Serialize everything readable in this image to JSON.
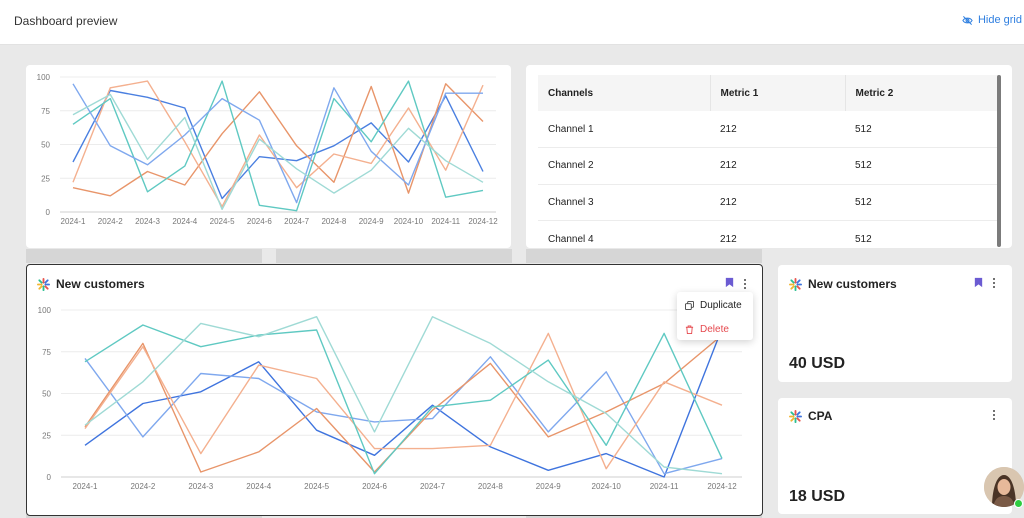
{
  "header": {
    "title": "Dashboard preview",
    "hide_grid_label": "Hide grid"
  },
  "colors": {
    "accent": "#2f7fe0",
    "delete": "#e5484d",
    "badge": "#6b5bd2",
    "border": "#333333"
  },
  "table": {
    "headers": [
      "Channels",
      "Metric 1",
      "Metric 2"
    ],
    "rows": [
      [
        "Channel 1",
        "212",
        "512"
      ],
      [
        "Channel 2",
        "212",
        "512"
      ],
      [
        "Channel 3",
        "212",
        "512"
      ],
      [
        "Channel 4",
        "212",
        "512"
      ]
    ]
  },
  "cards": {
    "new_customers_chart": {
      "title": "New customers"
    },
    "new_customers_metric": {
      "title": "New customers",
      "value": "40 USD"
    },
    "cpa_metric": {
      "title": "CPA",
      "value": "18 USD"
    }
  },
  "menu": {
    "duplicate_label": "Duplicate",
    "delete_label": "Delete"
  },
  "chart_data": [
    {
      "type": "line",
      "title": "",
      "xlabel": "",
      "ylabel": "",
      "categories": [
        "2024-1",
        "2024-2",
        "2024-3",
        "2024-4",
        "2024-5",
        "2024-6",
        "2024-7",
        "2024-8",
        "2024-9",
        "2024-10",
        "2024-11",
        "2024-12"
      ],
      "ylim": [
        0,
        100
      ],
      "yticks": [
        0,
        25,
        50,
        75,
        100
      ],
      "grid": true,
      "series": [
        {
          "color": "#4a7fe0",
          "values": [
            37,
            90,
            85,
            77,
            10,
            41,
            38,
            49,
            66,
            37,
            86,
            30
          ]
        },
        {
          "color": "#e8956a",
          "values": [
            18,
            12,
            30,
            20,
            58,
            89,
            49,
            22,
            93,
            14,
            95,
            67
          ]
        },
        {
          "color": "#f4b08f",
          "values": [
            22,
            92,
            97,
            52,
            4,
            57,
            18,
            43,
            36,
            77,
            31,
            94
          ]
        },
        {
          "color": "#5fc9c2",
          "values": [
            65,
            84,
            15,
            34,
            97,
            5,
            1,
            84,
            52,
            97,
            11,
            16
          ]
        },
        {
          "color": "#7fa8ee",
          "values": [
            95,
            49,
            35,
            57,
            84,
            68,
            7,
            92,
            45,
            20,
            88,
            88
          ]
        },
        {
          "color": "#9fdad5",
          "values": [
            72,
            87,
            39,
            70,
            2,
            54,
            32,
            14,
            31,
            62,
            38,
            22
          ]
        }
      ]
    },
    {
      "type": "line",
      "title": "New customers",
      "xlabel": "",
      "ylabel": "",
      "categories": [
        "2024-1",
        "2024-2",
        "2024-3",
        "2024-4",
        "2024-5",
        "2024-6",
        "2024-7",
        "2024-8",
        "2024-9",
        "2024-10",
        "2024-11",
        "2024-12"
      ],
      "ylim": [
        0,
        100
      ],
      "yticks": [
        0,
        25,
        50,
        75,
        100
      ],
      "grid": true,
      "series": [
        {
          "color": "#3f74de",
          "values": [
            19,
            44,
            51,
            69,
            28,
            13,
            43,
            18,
            4,
            14,
            0,
            89
          ]
        },
        {
          "color": "#7fa8ee",
          "values": [
            71,
            24,
            62,
            59,
            39,
            33,
            35,
            72,
            27,
            63,
            2,
            11
          ]
        },
        {
          "color": "#e8956a",
          "values": [
            30,
            80,
            3,
            15,
            41,
            3,
            40,
            68,
            24,
            39,
            56,
            85
          ]
        },
        {
          "color": "#f4b08f",
          "values": [
            29,
            78,
            14,
            67,
            59,
            17,
            17,
            19,
            86,
            5,
            57,
            43
          ]
        },
        {
          "color": "#5fc9c2",
          "values": [
            69,
            91,
            78,
            85,
            88,
            2,
            42,
            46,
            70,
            19,
            86,
            11
          ]
        },
        {
          "color": "#9fdad5",
          "values": [
            31,
            57,
            92,
            84,
            96,
            27,
            96,
            80,
            57,
            38,
            6,
            2
          ]
        }
      ]
    }
  ]
}
